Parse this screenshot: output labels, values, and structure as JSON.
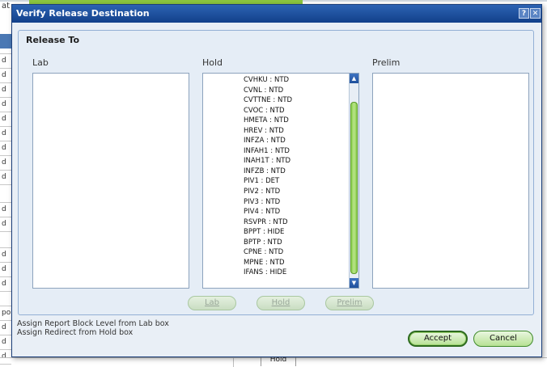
{
  "background": {
    "col_header_fragment": "at",
    "row_fragment": "d",
    "row_fragment_alt": "po",
    "bottom_cell_label": "Hold"
  },
  "dialog": {
    "title": "Verify Release Destination",
    "help_button": "?",
    "close_button": "✕",
    "group_title": "Release To",
    "columns": {
      "lab": "Lab",
      "hold": "Hold",
      "prelim": "Prelim"
    },
    "lists": {
      "lab": [],
      "hold": [
        "CVHKU : NTD",
        "CVNL : NTD",
        "CVTTNE : NTD",
        "CVOC : NTD",
        "HMETA : NTD",
        "HREV : NTD",
        "INFZA : NTD",
        "INFAH1 : NTD",
        "INAH1T : NTD",
        "INFZB : NTD",
        "PIV1 : DET",
        "PIV2 : NTD",
        "PIV3 : NTD",
        "PIV4 : NTD",
        "RSVPR : NTD",
        "BPPT : HIDE",
        "BPTP : NTD",
        "CPNE : NTD",
        "MPNE : NTD",
        "IFANS : HIDE"
      ],
      "prelim": []
    },
    "move_buttons": {
      "lab": "Lab",
      "hold": "Hold",
      "prelim": "Prelim"
    },
    "notes": [
      "Assign Report Block Level from Lab box",
      "Assign Redirect from Hold box"
    ],
    "accept_button": "Accept",
    "cancel_button": "Cancel"
  },
  "icons": {
    "scroll_up": "up-arrow-icon",
    "scroll_down": "down-arrow-icon"
  },
  "colors": {
    "titlebar": "#1b4b95",
    "accent_green": "#8ad04c"
  }
}
